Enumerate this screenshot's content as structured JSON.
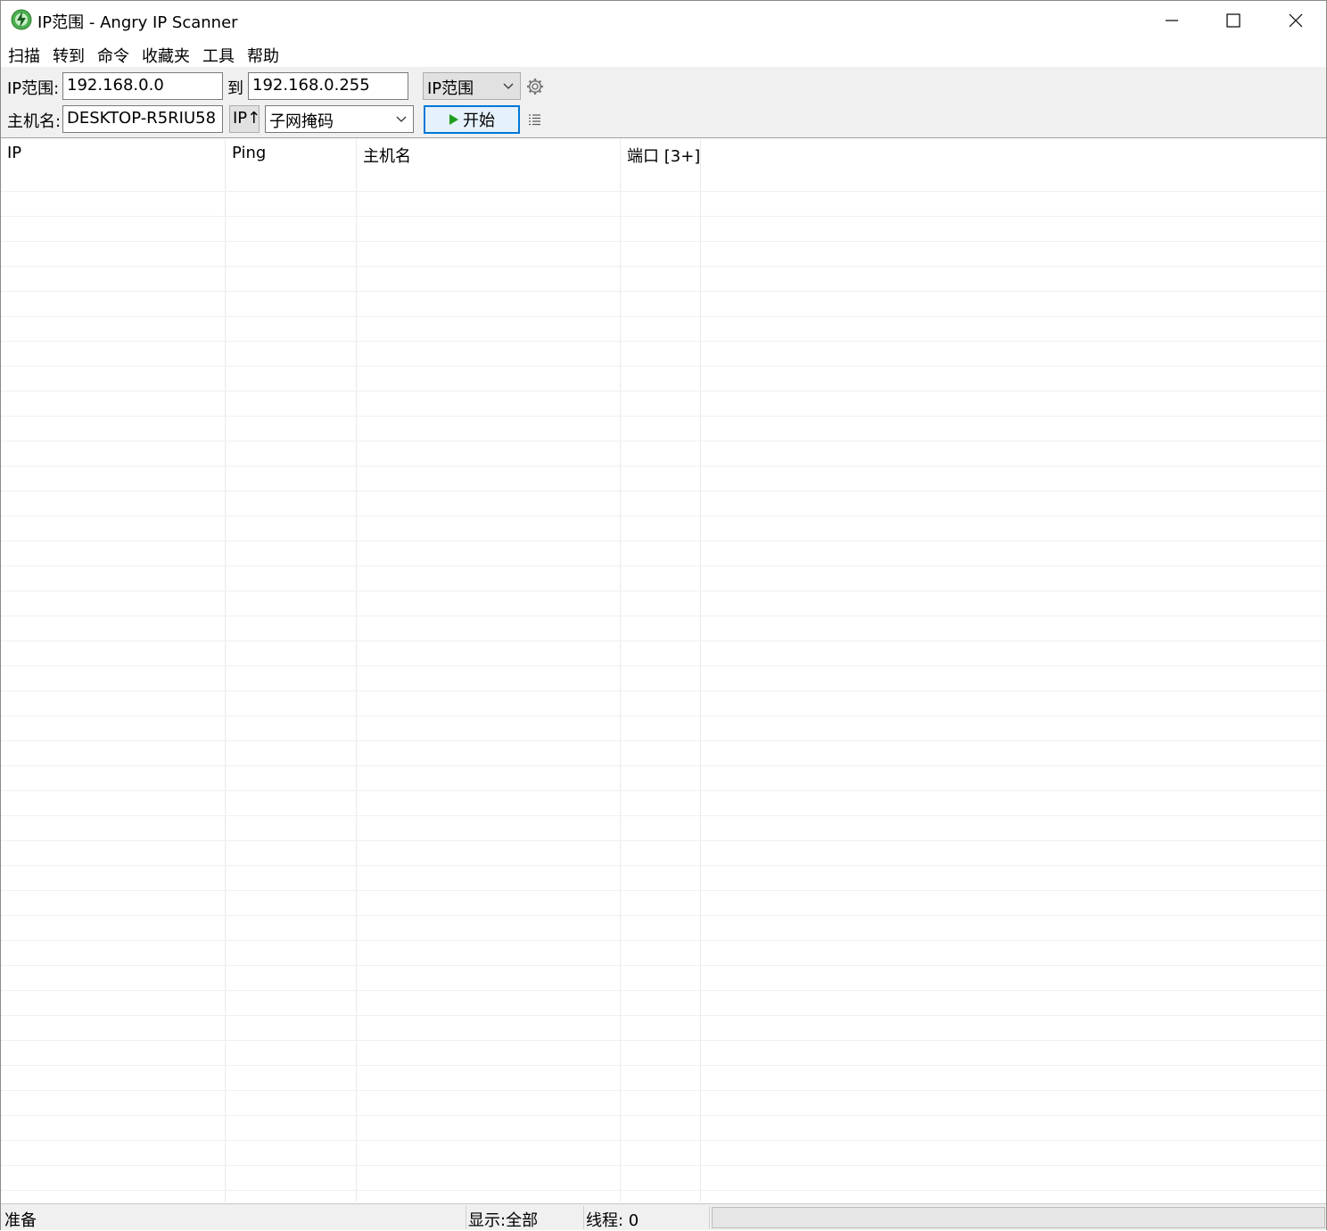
{
  "window": {
    "title": "IP范围 - Angry IP Scanner"
  },
  "menu": [
    "扫描",
    "转到",
    "命令",
    "收藏夹",
    "工具",
    "帮助"
  ],
  "toolbar": {
    "ip_range_label": "IP范围:",
    "ip_from": "192.168.0.0",
    "to_label": "到",
    "ip_to": "192.168.0.255",
    "feeder_select": "IP范围",
    "hostname_label": "主机名:",
    "hostname": "DESKTOP-R5RIU58",
    "ip_sort_label": "IP↑",
    "netmask_select": "子网掩码",
    "start_label": "开始"
  },
  "table": {
    "columns": [
      "IP",
      "Ping",
      "主机名",
      "端口 [3+]"
    ],
    "rows": []
  },
  "status": {
    "state": "准备",
    "display": "显示:全部",
    "threads": "线程: 0"
  },
  "colors": {
    "accent": "#0078d7",
    "play": "#1e9e1e",
    "toolbar_bg": "#f0f0f0"
  }
}
